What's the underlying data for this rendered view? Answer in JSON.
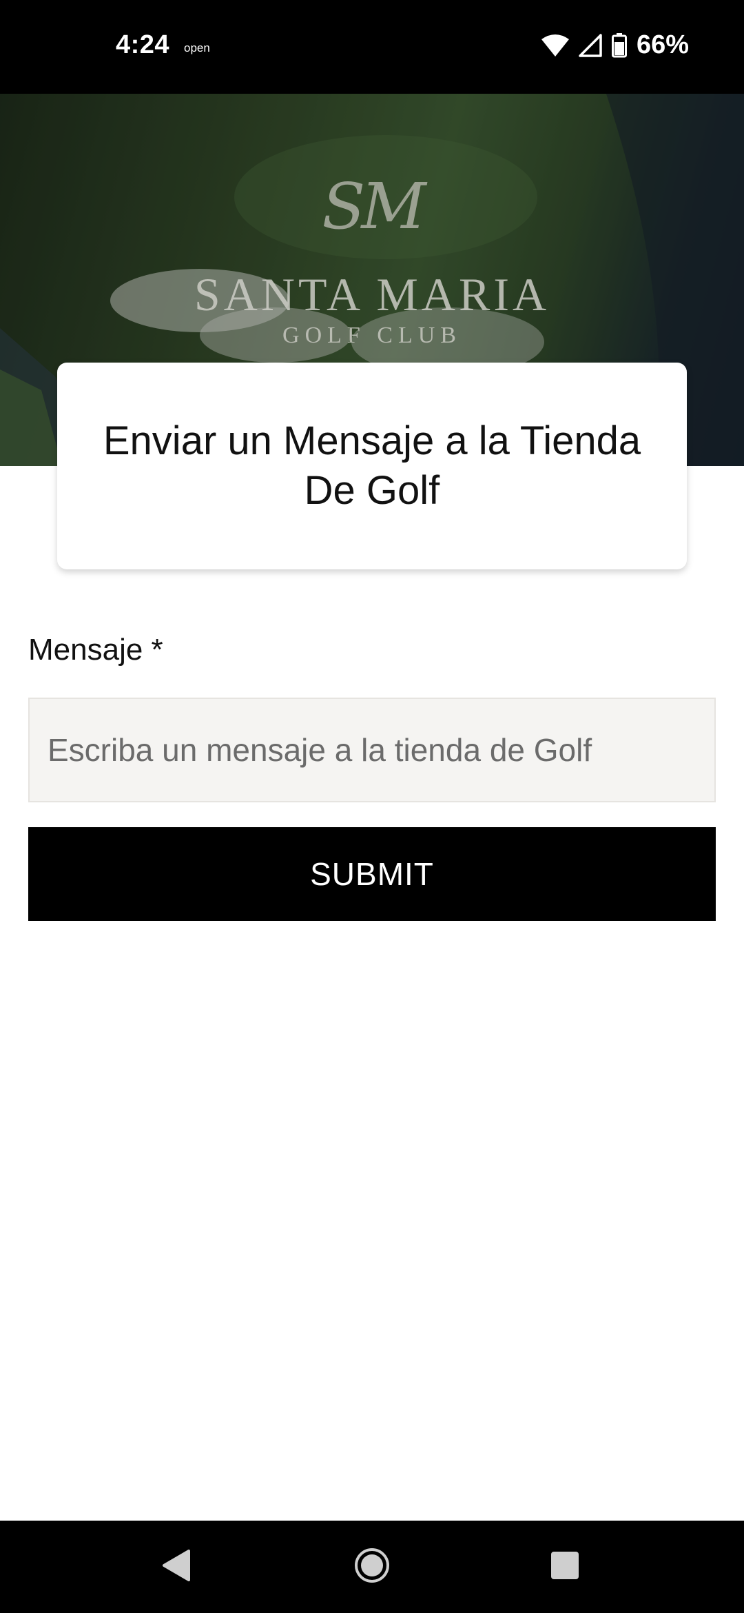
{
  "status_bar": {
    "time": "4:24",
    "note": "open",
    "battery_percent": "66%",
    "icons": [
      "wifi-icon",
      "cell-signal-icon",
      "battery-icon"
    ]
  },
  "hero": {
    "monogram": "SM",
    "club_name": "SANTA MARIA",
    "club_subtitle": "GOLF CLUB"
  },
  "title_card": {
    "title": "Enviar un Mensaje a la Tienda De Golf"
  },
  "form": {
    "message_label": "Mensaje *",
    "message_placeholder": "Escriba un mensaje a la tienda de Golf",
    "message_value": "",
    "submit_label": "SUBMIT"
  },
  "nav_bar": {
    "icons": [
      "back-icon",
      "home-icon",
      "recents-icon"
    ]
  },
  "colors": {
    "status_bar_bg": "#000000",
    "button_bg": "#000000",
    "button_text": "#ffffff",
    "input_bg": "#f5f4f2",
    "text": "#111111"
  }
}
